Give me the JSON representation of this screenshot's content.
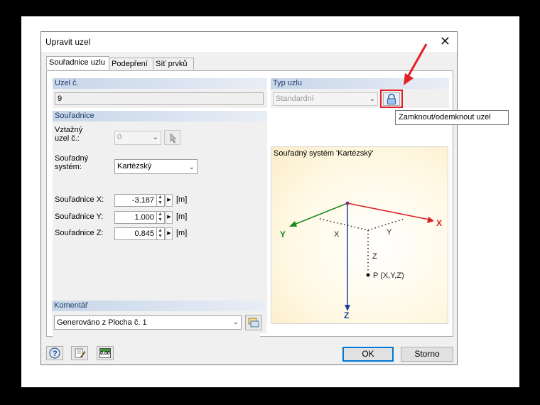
{
  "dialog": {
    "title": "Upravit uzel",
    "close_glyph": "✕"
  },
  "tabs": [
    {
      "label": "Souřadnice uzlu"
    },
    {
      "label": "Podepření"
    },
    {
      "label": "Síť prvků"
    }
  ],
  "node": {
    "header": "Uzel č.",
    "value": "9"
  },
  "node_type": {
    "header": "Typ uzlu",
    "value": "Standardní",
    "lock_tooltip": "Zamknout/odemknout uzel"
  },
  "coordinates": {
    "header": "Souřadnice",
    "ref_label_1": "Vztažný",
    "ref_label_2": "uzel č.:",
    "ref_value": "0",
    "sys_label_1": "Souřadný",
    "sys_label_2": "systém:",
    "sys_value": "Kartézský",
    "rows": [
      {
        "label": "Souřadnice X:",
        "value": "-3.187",
        "unit": "[m]"
      },
      {
        "label": "Souřadnice Y:",
        "value": "1.000",
        "unit": "[m]"
      },
      {
        "label": "Souřadnice Z:",
        "value": "0.845",
        "unit": "[m]"
      }
    ]
  },
  "comment": {
    "header": "Komentář",
    "value": "Generováno z Plocha č. 1"
  },
  "diagram": {
    "title": "Souřadný systém 'Kartézský'",
    "axis_x": "X",
    "axis_y": "Y",
    "axis_z": "Z",
    "proj_x": "X",
    "proj_y": "Y",
    "proj_z": "Z",
    "point_label": "P (X,Y,Z)"
  },
  "footer": {
    "ok": "OK",
    "cancel": "Storno",
    "calc_icon_text": "0.00"
  },
  "colors": {
    "x_axis": "#d62020",
    "y_axis": "#1a8a1a",
    "z_axis": "#1f3f9a",
    "highlight": "#e41f26"
  }
}
